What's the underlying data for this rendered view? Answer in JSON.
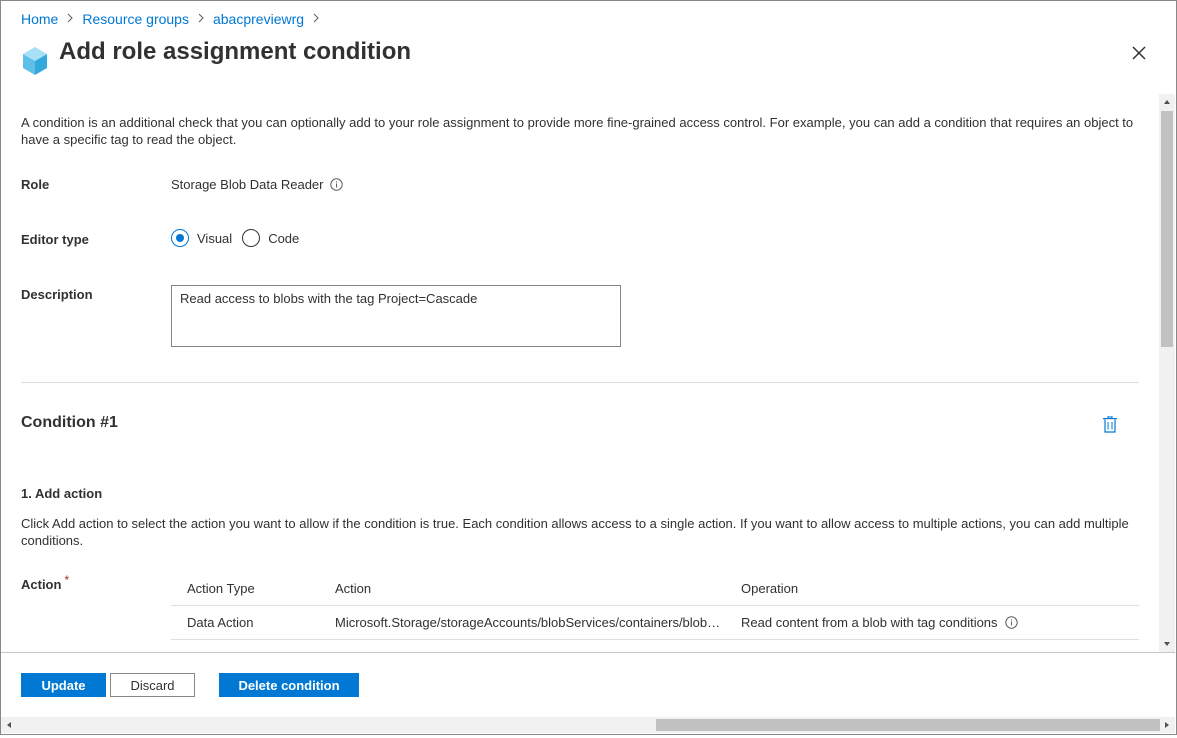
{
  "breadcrumb": [
    {
      "label": "Home"
    },
    {
      "label": "Resource groups"
    },
    {
      "label": "abacpreviewrg"
    }
  ],
  "page_title": "Add role assignment condition",
  "intro_text": "A condition is an additional check that you can optionally add to your role assignment to provide more fine-grained access control. For example, you can add a condition that requires an object to have a specific tag to read the object.",
  "role": {
    "label": "Role",
    "value": "Storage Blob Data Reader"
  },
  "editor_type": {
    "label": "Editor type",
    "options": [
      {
        "label": "Visual",
        "selected": true
      },
      {
        "label": "Code",
        "selected": false
      }
    ]
  },
  "description": {
    "label": "Description",
    "value": "Read access to blobs with the tag Project=Cascade"
  },
  "condition": {
    "title": "Condition #1",
    "step_title": "1. Add action",
    "step_text": "Click Add action to select the action you want to allow if the condition is true. Each condition allows access to a single action. If you want to allow access to multiple actions, you can add multiple conditions.",
    "action_label": "Action",
    "required_mark": "*",
    "table": {
      "headers": [
        "Action Type",
        "Action",
        "Operation"
      ],
      "rows": [
        [
          "Data Action",
          "Microsoft.Storage/storageAccounts/blobServices/containers/blobs/read",
          "Read content from a blob with tag conditions"
        ]
      ]
    }
  },
  "footer": {
    "update_label": "Update",
    "discard_label": "Discard",
    "delete_label": "Delete condition"
  },
  "colors": {
    "accent": "#0078d4",
    "text": "#323130",
    "required": "#a4262c"
  }
}
